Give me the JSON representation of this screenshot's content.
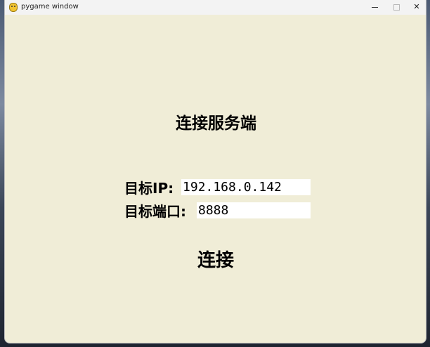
{
  "window": {
    "title": "pygame window",
    "icon": "pygame-snake-icon",
    "controls": {
      "minimize": "minimize-icon",
      "maximize": "maximize-icon",
      "close": "✕"
    }
  },
  "main": {
    "heading": "连接服务端",
    "ip_label": "目标IP:",
    "ip_value": "192.168.0.142",
    "port_label": "目标端口:",
    "port_value": "8888",
    "connect_label": "连接"
  },
  "colors": {
    "background": "#f0edd7",
    "field": "#ffffff",
    "text": "#000000"
  }
}
